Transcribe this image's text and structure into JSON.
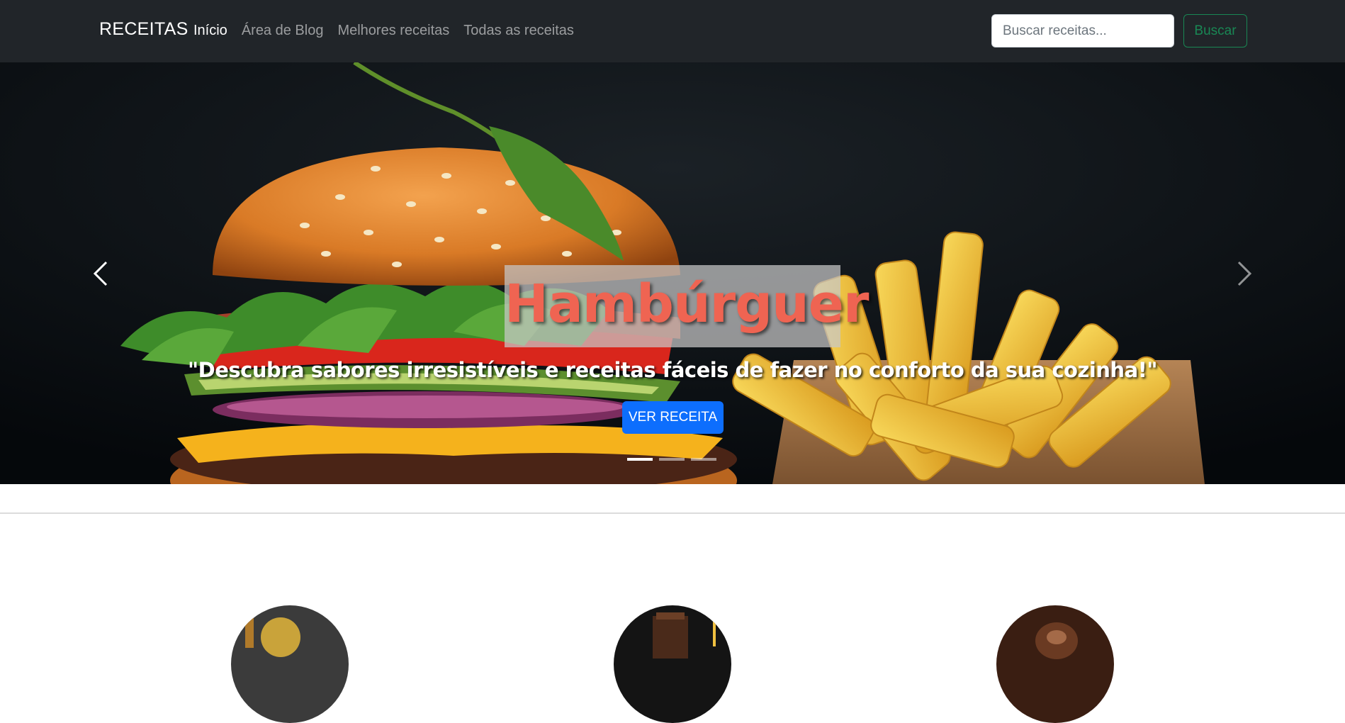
{
  "navbar": {
    "brand": "RECEITAS",
    "links": [
      {
        "label": "Início",
        "active": true
      },
      {
        "label": "Área de Blog",
        "active": false
      },
      {
        "label": "Melhores receitas",
        "active": false
      },
      {
        "label": "Todas as receitas",
        "active": false
      }
    ],
    "search": {
      "placeholder": "Buscar receitas...",
      "value": ""
    },
    "search_button": "Buscar"
  },
  "carousel": {
    "title": "Hambúrguer",
    "subtitle": "\"Descubra sabores irresistíveis e receitas fáceis de fazer no conforto da sua cozinha!\"",
    "button": "VER RECEITA",
    "slide_count": 3,
    "active_slide": 1,
    "prev_icon": "chevron-left-icon",
    "next_icon": "chevron-right-icon"
  },
  "featured": {
    "items": [
      {
        "image": "recipe-thumbnail-1"
      },
      {
        "image": "recipe-thumbnail-2"
      },
      {
        "image": "recipe-thumbnail-3"
      }
    ]
  },
  "colors": {
    "navbar_bg": "#212529",
    "title": "#ef6452",
    "primary_button": "#0d6efd",
    "success_outline": "#198754"
  }
}
